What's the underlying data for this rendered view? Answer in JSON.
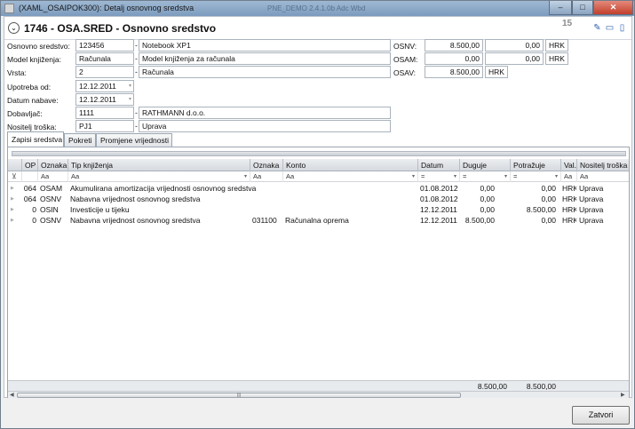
{
  "window": {
    "title": "(XAML_OSAIPOK300): Detalj osnovnog sredstva",
    "ghost_text": "PNE_DEMO 2.4.1.0b Adc Wbd",
    "min": "–",
    "max": "□",
    "close": "✕"
  },
  "header": {
    "expand": "⌄",
    "title": "1746  -  OSA.SRED  -  Osnovno sredstvo",
    "page_count": "15"
  },
  "form": {
    "osnovno_sredstvo": {
      "label": "Osnovno sredstvo:",
      "code": "123456",
      "name": "Notebook XP1"
    },
    "model_knjizenja": {
      "label": "Model knjiženja:",
      "code": "Računala",
      "name": "Model knjiženja za računala"
    },
    "vrsta": {
      "label": "Vrsta:",
      "code": "2",
      "name": "Računala"
    },
    "upotreba_od": {
      "label": "Upotreba od:",
      "value": "12.12.2011"
    },
    "datum_nabave": {
      "label": "Datum nabave:",
      "value": "12.12.2011"
    },
    "dobavljac": {
      "label": "Dobavljač:",
      "code": "1111",
      "name": "RATHMANN d.o.o."
    },
    "nositelj_troska": {
      "label": "Nositelj troška:",
      "code": "PJ1",
      "name": "Uprava"
    },
    "osnv": {
      "label": "OSNV:",
      "value1": "8.500,00",
      "value2": "0,00",
      "currency": "HRK"
    },
    "osam": {
      "label": "OSAM:",
      "value1": "0,00",
      "value2": "0,00",
      "currency": "HRK"
    },
    "osav": {
      "label": "OSAV:",
      "value1": "8.500,00",
      "currency": "HRK"
    }
  },
  "tabs": [
    "Zapisi sredstva",
    "Pokreti",
    "Promjene vrijednosti"
  ],
  "grid": {
    "columns": [
      "OP",
      "Oznaka",
      "Tip knjiženja",
      "Oznaka",
      "Konto",
      "Datum",
      "Duguje",
      "Potražuje",
      "Val.",
      "Nositelj troška"
    ],
    "filters": [
      "",
      "Aa",
      "Aa",
      "Aa",
      "Aa",
      "=",
      "=",
      "=",
      "Aa",
      "Aa"
    ],
    "rows": [
      {
        "op": "064",
        "oznaka": "OSAM",
        "tip": "Akumulirana amortizacija vrijednosti osnovnog sredstva",
        "oznaka2": "",
        "konto": "",
        "datum": "01.08.2012",
        "duguje": "0,00",
        "potrazuje": "0,00",
        "val": "HRK",
        "nositelj": "Uprava"
      },
      {
        "op": "064",
        "oznaka": "OSNV",
        "tip": "Nabavna vrijednost osnovnog sredstva",
        "oznaka2": "",
        "konto": "",
        "datum": "01.08.2012",
        "duguje": "0,00",
        "potrazuje": "0,00",
        "val": "HRK",
        "nositelj": "Uprava"
      },
      {
        "op": "0",
        "oznaka": "OSIN",
        "tip": "Investicije u tijeku",
        "oznaka2": "",
        "konto": "",
        "datum": "12.12.2011",
        "duguje": "0,00",
        "potrazuje": "8.500,00",
        "val": "HRK",
        "nositelj": "Uprava"
      },
      {
        "op": "0",
        "oznaka": "OSNV",
        "tip": "Nabavna vrijednost osnovnog sredstva",
        "oznaka2": "031100",
        "konto": "Računalna oprema",
        "datum": "12.12.2011",
        "duguje": "8.500,00",
        "potrazuje": "0,00",
        "val": "HRK",
        "nositelj": "Uprava"
      }
    ],
    "totals": {
      "duguje": "8.500,00",
      "potrazuje": "8.500,00"
    }
  },
  "footer": {
    "close_label": "Zatvori"
  }
}
